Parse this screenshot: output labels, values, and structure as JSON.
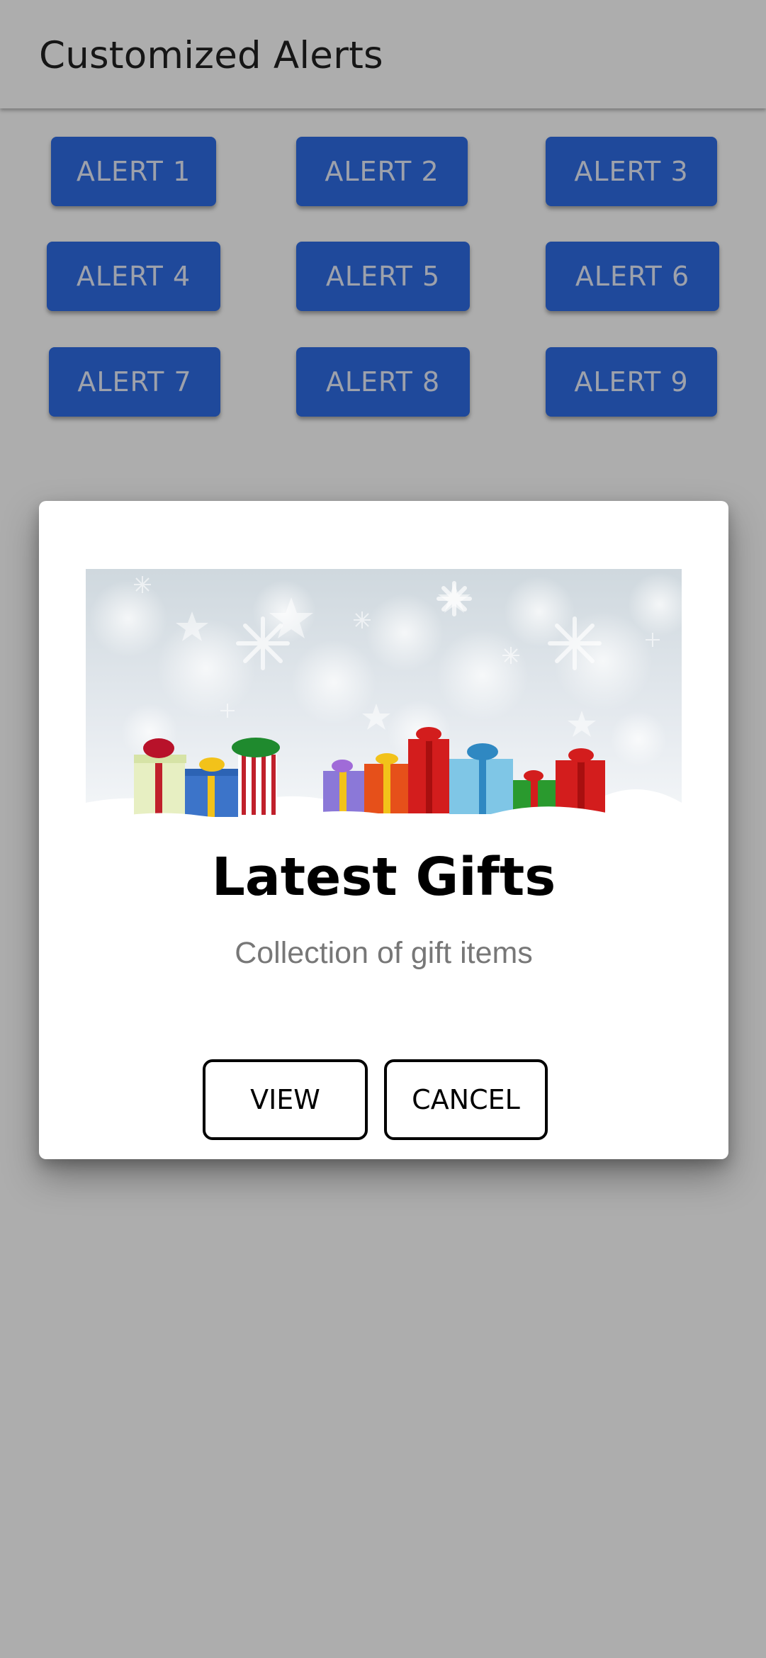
{
  "app_bar": {
    "title": "Customized Alerts"
  },
  "alert_buttons": [
    {
      "label": "ALERT 1"
    },
    {
      "label": "ALERT 2"
    },
    {
      "label": "ALERT 3"
    },
    {
      "label": "ALERT 4"
    },
    {
      "label": "ALERT 5"
    },
    {
      "label": "ALERT 6"
    },
    {
      "label": "ALERT 7"
    },
    {
      "label": "ALERT 8"
    },
    {
      "label": "ALERT 9"
    }
  ],
  "dialog": {
    "title": "Latest Gifts",
    "subtitle": "Collection of gift items",
    "view_label": "VIEW",
    "cancel_label": "CANCEL",
    "banner_icon": "gift-boxes-in-snow-image"
  },
  "colors": {
    "button_blue": "#2f6ce5",
    "scrim": "rgba(0,0,0,0.32)"
  }
}
